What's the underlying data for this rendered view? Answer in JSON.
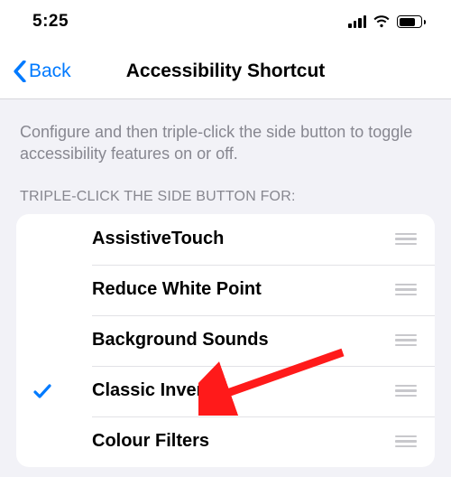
{
  "status": {
    "time": "5:25"
  },
  "nav": {
    "back_label": "Back",
    "title": "Accessibility Shortcut"
  },
  "section": {
    "description": "Configure and then triple-click the side button to toggle accessibility features on or off.",
    "header": "TRIPLE-CLICK THE SIDE BUTTON FOR:"
  },
  "rows": [
    {
      "label": "AssistiveTouch",
      "checked": false
    },
    {
      "label": "Reduce White Point",
      "checked": false
    },
    {
      "label": "Background Sounds",
      "checked": false
    },
    {
      "label": "Classic Invert",
      "checked": true
    },
    {
      "label": "Colour Filters",
      "checked": false
    }
  ],
  "colors": {
    "accent": "#007aff",
    "annotation": "#ff1a1a"
  }
}
